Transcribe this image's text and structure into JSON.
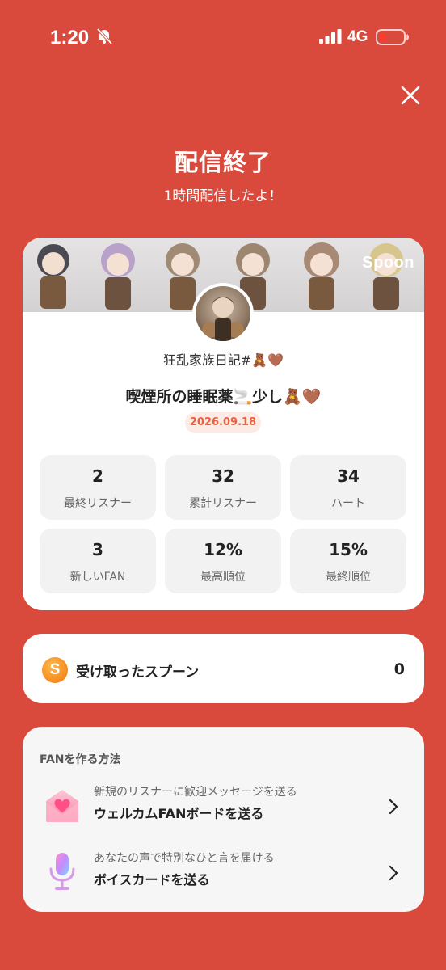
{
  "status_bar": {
    "time": "1:20",
    "network": "4G"
  },
  "header": {
    "title": "配信終了",
    "subtitle": "1時間配信したよ！"
  },
  "banner": {
    "logo": "Spoon"
  },
  "broadcast": {
    "channel_name": "狂乱家族日記#🧸🤎",
    "title": "喫煙所の睡眠薬🚬少し🧸🤎",
    "date": "2026.09.18"
  },
  "stats": [
    {
      "value": "2",
      "label": "最終リスナー"
    },
    {
      "value": "32",
      "label": "累計リスナー"
    },
    {
      "value": "34",
      "label": "ハート"
    },
    {
      "value": "3",
      "label": "新しいFAN"
    },
    {
      "value": "12%",
      "label": "最高順位"
    },
    {
      "value": "15%",
      "label": "最終順位"
    }
  ],
  "spoons": {
    "icon_letter": "S",
    "label": "受け取ったスプーン",
    "count": "0"
  },
  "fan_section": {
    "heading": "FANを作る方法",
    "items": [
      {
        "icon": "heart-envelope-icon",
        "sub": "新規のリスナーに歓迎メッセージを送る",
        "main": "ウェルカムFANボードを送る"
      },
      {
        "icon": "microphone-icon",
        "sub": "あなたの声で特別なひと言を届ける",
        "main": "ボイスカードを送る"
      }
    ]
  },
  "colors": {
    "background": "#D94A3C",
    "date_badge_text": "#E8623E",
    "spoon_orange": "#F58A1F"
  }
}
